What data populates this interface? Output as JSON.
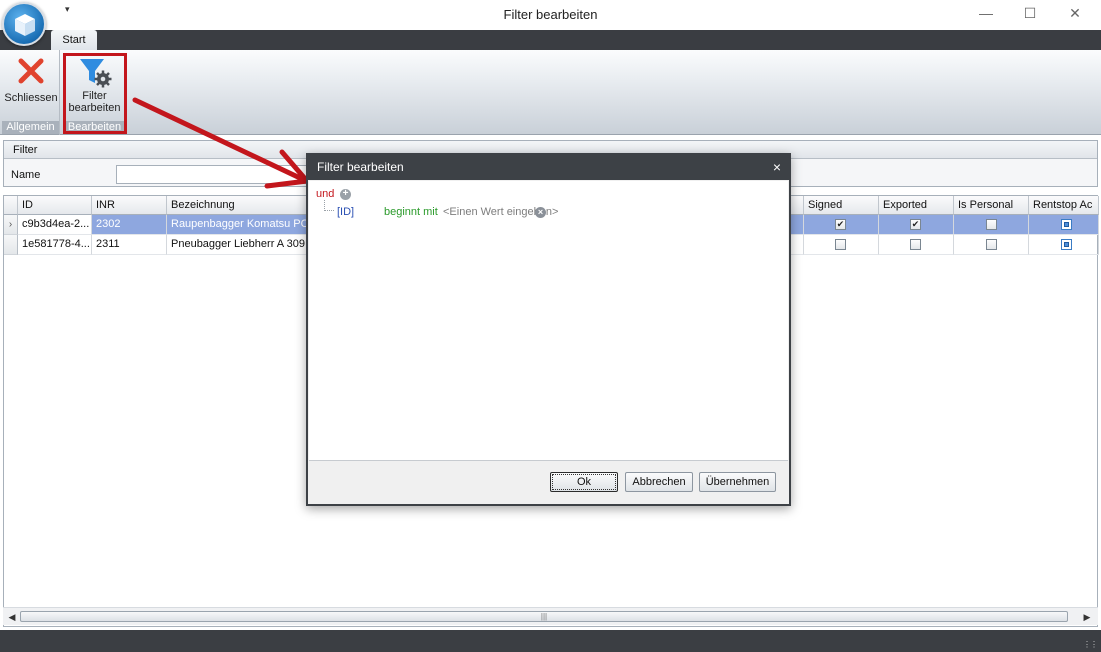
{
  "window": {
    "title": "Filter bearbeiten",
    "qat_glyph": "▾"
  },
  "ribbon": {
    "tab_start": "Start",
    "groups": [
      {
        "label": "Allgemein",
        "button": "Schliessen"
      },
      {
        "label": "Bearbeiten",
        "button_line1": "Filter",
        "button_line2": "bearbeiten"
      }
    ]
  },
  "filter_panel": {
    "header": "Filter",
    "name_label": "Name",
    "name_value": ""
  },
  "grid": {
    "columns": [
      "ID",
      "INR",
      "Bezeichnung",
      "Signed",
      "Exported",
      "Is Personal",
      "Rentstop Ac"
    ],
    "rows": [
      {
        "id": "c9b3d4ea-2...",
        "inr": "2302",
        "bezeichnung": "Raupenbagger Komatsu PC",
        "signed": true,
        "exported": true,
        "is_personal": false,
        "rentstop": "indeterminate",
        "selected": true,
        "indicator": "›"
      },
      {
        "id": "1e581778-4...",
        "inr": "2311",
        "bezeichnung": "Pneubagger Liebherr A 309 (",
        "signed": false,
        "exported": false,
        "is_personal": false,
        "rentstop": "indeterminate",
        "selected": false,
        "indicator": ""
      }
    ],
    "scroll_thumb": "|||"
  },
  "dialog": {
    "title": "Filter bearbeiten",
    "close_glyph": "×",
    "group_operator": "und",
    "condition": {
      "field": "[ID]",
      "operator": "beginnt mit",
      "value_placeholder": "<Einen Wert eingeben>"
    },
    "buttons": {
      "ok": "Ok",
      "cancel": "Abbrechen",
      "apply": "Übernehmen"
    }
  },
  "colors": {
    "accent_red": "#c3161c",
    "selection": "#8ea7df",
    "dark_chrome": "#3d4146"
  }
}
